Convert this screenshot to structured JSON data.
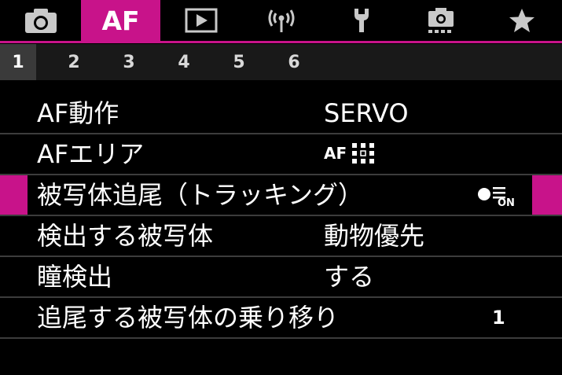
{
  "tabs": [
    {
      "name": "shooting",
      "icon": "camera-icon"
    },
    {
      "name": "af",
      "label": "AF",
      "active": true
    },
    {
      "name": "playback",
      "icon": "play-icon"
    },
    {
      "name": "wireless",
      "icon": "wireless-icon"
    },
    {
      "name": "setup",
      "icon": "wrench-icon"
    },
    {
      "name": "custom",
      "icon": "custom-camera-icon"
    },
    {
      "name": "mymenu",
      "icon": "star-icon"
    }
  ],
  "af_tab_label": "AF",
  "pages": [
    "1",
    "2",
    "3",
    "4",
    "5",
    "6"
  ],
  "active_page": "1",
  "menu": [
    {
      "label": "AF動作",
      "value": "SERVO"
    },
    {
      "label": "AFエリア",
      "value_icon": "af-area-grid-icon",
      "value_text": "AF"
    },
    {
      "label": "被写体追尾（トラッキング）",
      "value_icon": "tracking-on-icon",
      "value_text": "ON",
      "selected": true
    },
    {
      "label": "検出する被写体",
      "value": "動物優先"
    },
    {
      "label": "瞳検出",
      "value": "する"
    },
    {
      "label": "追尾する被写体の乗り移り",
      "value": "1"
    }
  ],
  "colors": {
    "accent": "#c8138a",
    "background": "#000000",
    "pagebar": "#191919"
  }
}
